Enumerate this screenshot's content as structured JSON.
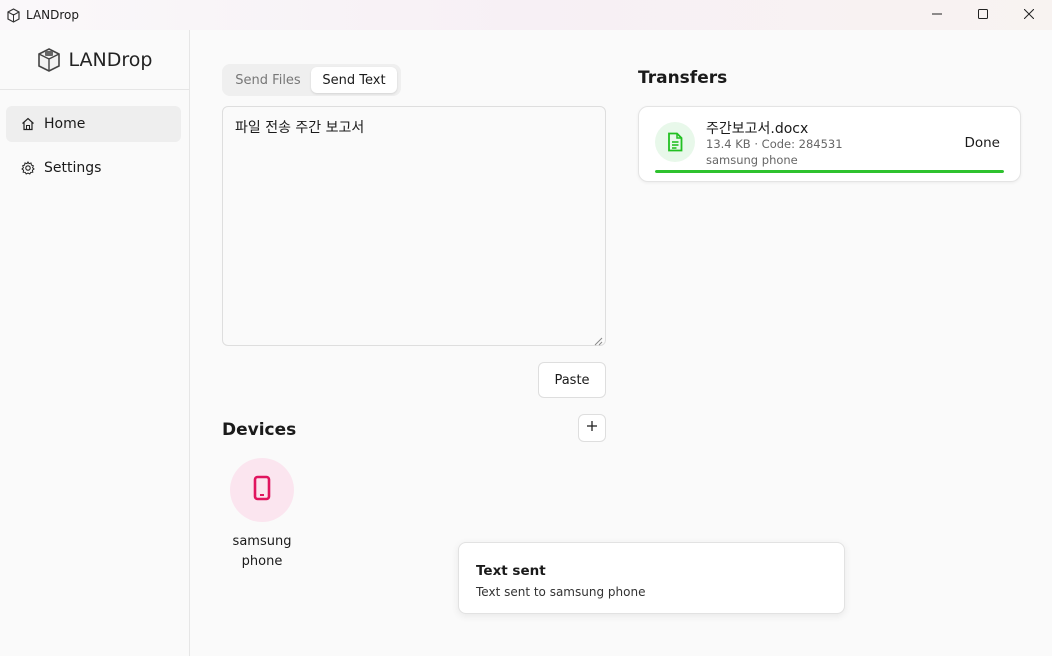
{
  "window": {
    "title": "LANDrop",
    "icons": {
      "app": "lock-box-icon",
      "minimize": "minimize-icon",
      "maximize": "maximize-icon",
      "close": "close-icon"
    }
  },
  "sidebar": {
    "brand": "LANDrop",
    "items": [
      {
        "label": "Home",
        "icon": "home-icon",
        "active": true
      },
      {
        "label": "Settings",
        "icon": "gear-icon",
        "active": false
      }
    ]
  },
  "send": {
    "tabs": [
      {
        "label": "Send Files",
        "active": false
      },
      {
        "label": "Send Text",
        "active": true
      }
    ],
    "text_value": "파일 전송 주간 보고서",
    "paste_label": "Paste"
  },
  "devices": {
    "title": "Devices",
    "add_icon": "plus-icon",
    "list": [
      {
        "name": "samsung phone",
        "icon": "smartphone-icon",
        "color": "#e0155f"
      }
    ]
  },
  "transfers": {
    "title": "Transfers",
    "items": [
      {
        "file_name": "주간보고서.docx",
        "meta": "13.4 KB · Code: 284531",
        "device": "samsung phone",
        "status": "Done",
        "progress": 1.0,
        "icon": "document-icon",
        "color": "#22c022"
      }
    ]
  },
  "toast": {
    "title": "Text sent",
    "message": "Text sent to samsung phone"
  }
}
